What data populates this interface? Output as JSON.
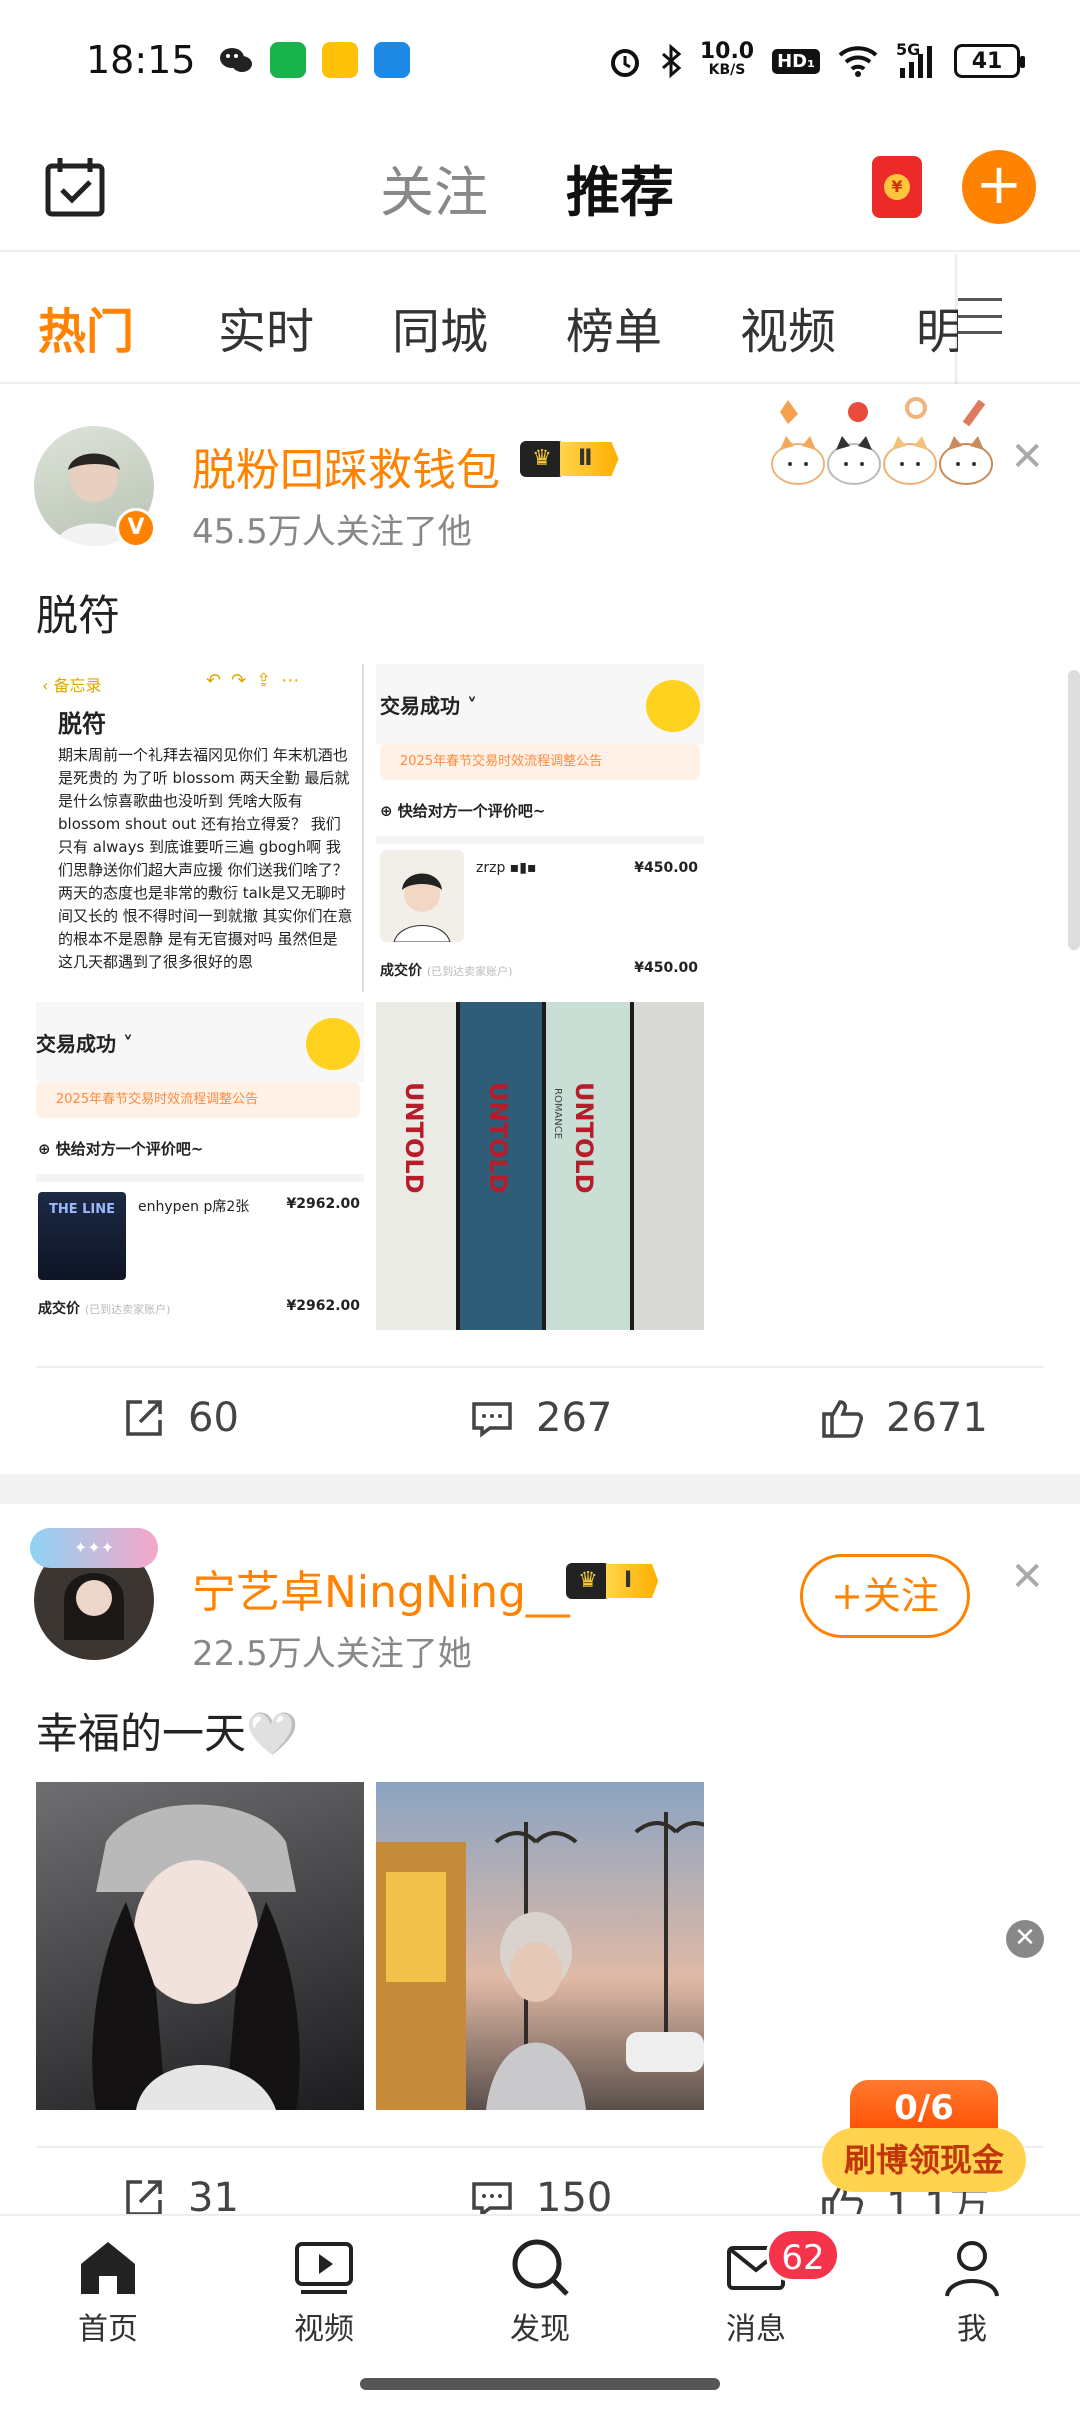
{
  "status_bar": {
    "time": "18:15",
    "network_speed_top": "10.0",
    "network_speed_unit": "KB/S",
    "hd_label": "HD₁",
    "signal_label": "5G",
    "battery": "41"
  },
  "header": {
    "tab_follow": "关注",
    "tab_recommend": "推荐",
    "redpack_coin": "¥",
    "add_symbol": "+"
  },
  "categories": {
    "items": [
      "热门",
      "实时",
      "同城",
      "榜单",
      "视频",
      "明"
    ]
  },
  "post1": {
    "username": "脱粉回踩救钱包",
    "level": "Ⅱ",
    "followers": "45.5万人关注了他",
    "vbadge": "V",
    "text": "脱符",
    "close": "✕",
    "memo": {
      "back": "备忘录",
      "title": "脱符",
      "body": "期末周前一个礼拜去福冈见你们 年末机酒也是死贵的 为了听 blossom 两天全勤 最后就是什么惊喜歌曲也没听到 凭啥大阪有 blossom shout out 还有抬立得爱？ 我们只有 always 到底谁要听三遍 gbogh啊 我们思静送你们超大声应援 你们送我们啥了？ 两天的态度也是非常的敷衍 talk是又无聊时间又长的 恨不得时间一到就撤 其实你们在意的根本不是恩静 是有无官摄对吗 虽然但是 这几天都遇到了很多很好的恩"
    },
    "order1": {
      "status": "交易成功",
      "notice": "2025年春节交易时效流程调整公告",
      "review": "快给对方一个评价吧~",
      "seller": "zrzp",
      "price": "¥450.00",
      "deal_label": "成交价",
      "deal_note": "(已到达卖家账户)",
      "deal_price": "¥450.00"
    },
    "order2": {
      "status": "交易成功",
      "notice": "2025年春节交易时效流程调整公告",
      "review": "快给对方一个评价吧~",
      "item": "enhypen p席2张",
      "price": "¥2962.00",
      "deal_label": "成交价",
      "deal_note": "(已到达卖家账户)",
      "deal_price": "¥2962.00",
      "thumb_text": "THE LINE"
    },
    "album_text": "UNTOLD",
    "album_sub": "ROMANCE",
    "actions": {
      "repost": "60",
      "comment": "267",
      "like": "2671"
    }
  },
  "post2": {
    "username": "宁艺卓NingNing__",
    "level": "Ⅰ",
    "followers": "22.5万人关注了她",
    "text": "幸福的一天🤍",
    "follow_btn": "+关注",
    "close": "✕",
    "actions": {
      "repost": "31",
      "comment": "150",
      "like": "1.1万"
    }
  },
  "floating": {
    "ad_close": "✕",
    "task_progress": "0/6",
    "task_label": "刷博领现金"
  },
  "bottom_nav": {
    "home": "首页",
    "video": "视频",
    "discover": "发现",
    "messages": "消息",
    "messages_badge": "62",
    "me": "我"
  },
  "colors": {
    "accent": "#ff8200",
    "tab_underline": "#ffb400",
    "badge_red": "#f5334a"
  }
}
